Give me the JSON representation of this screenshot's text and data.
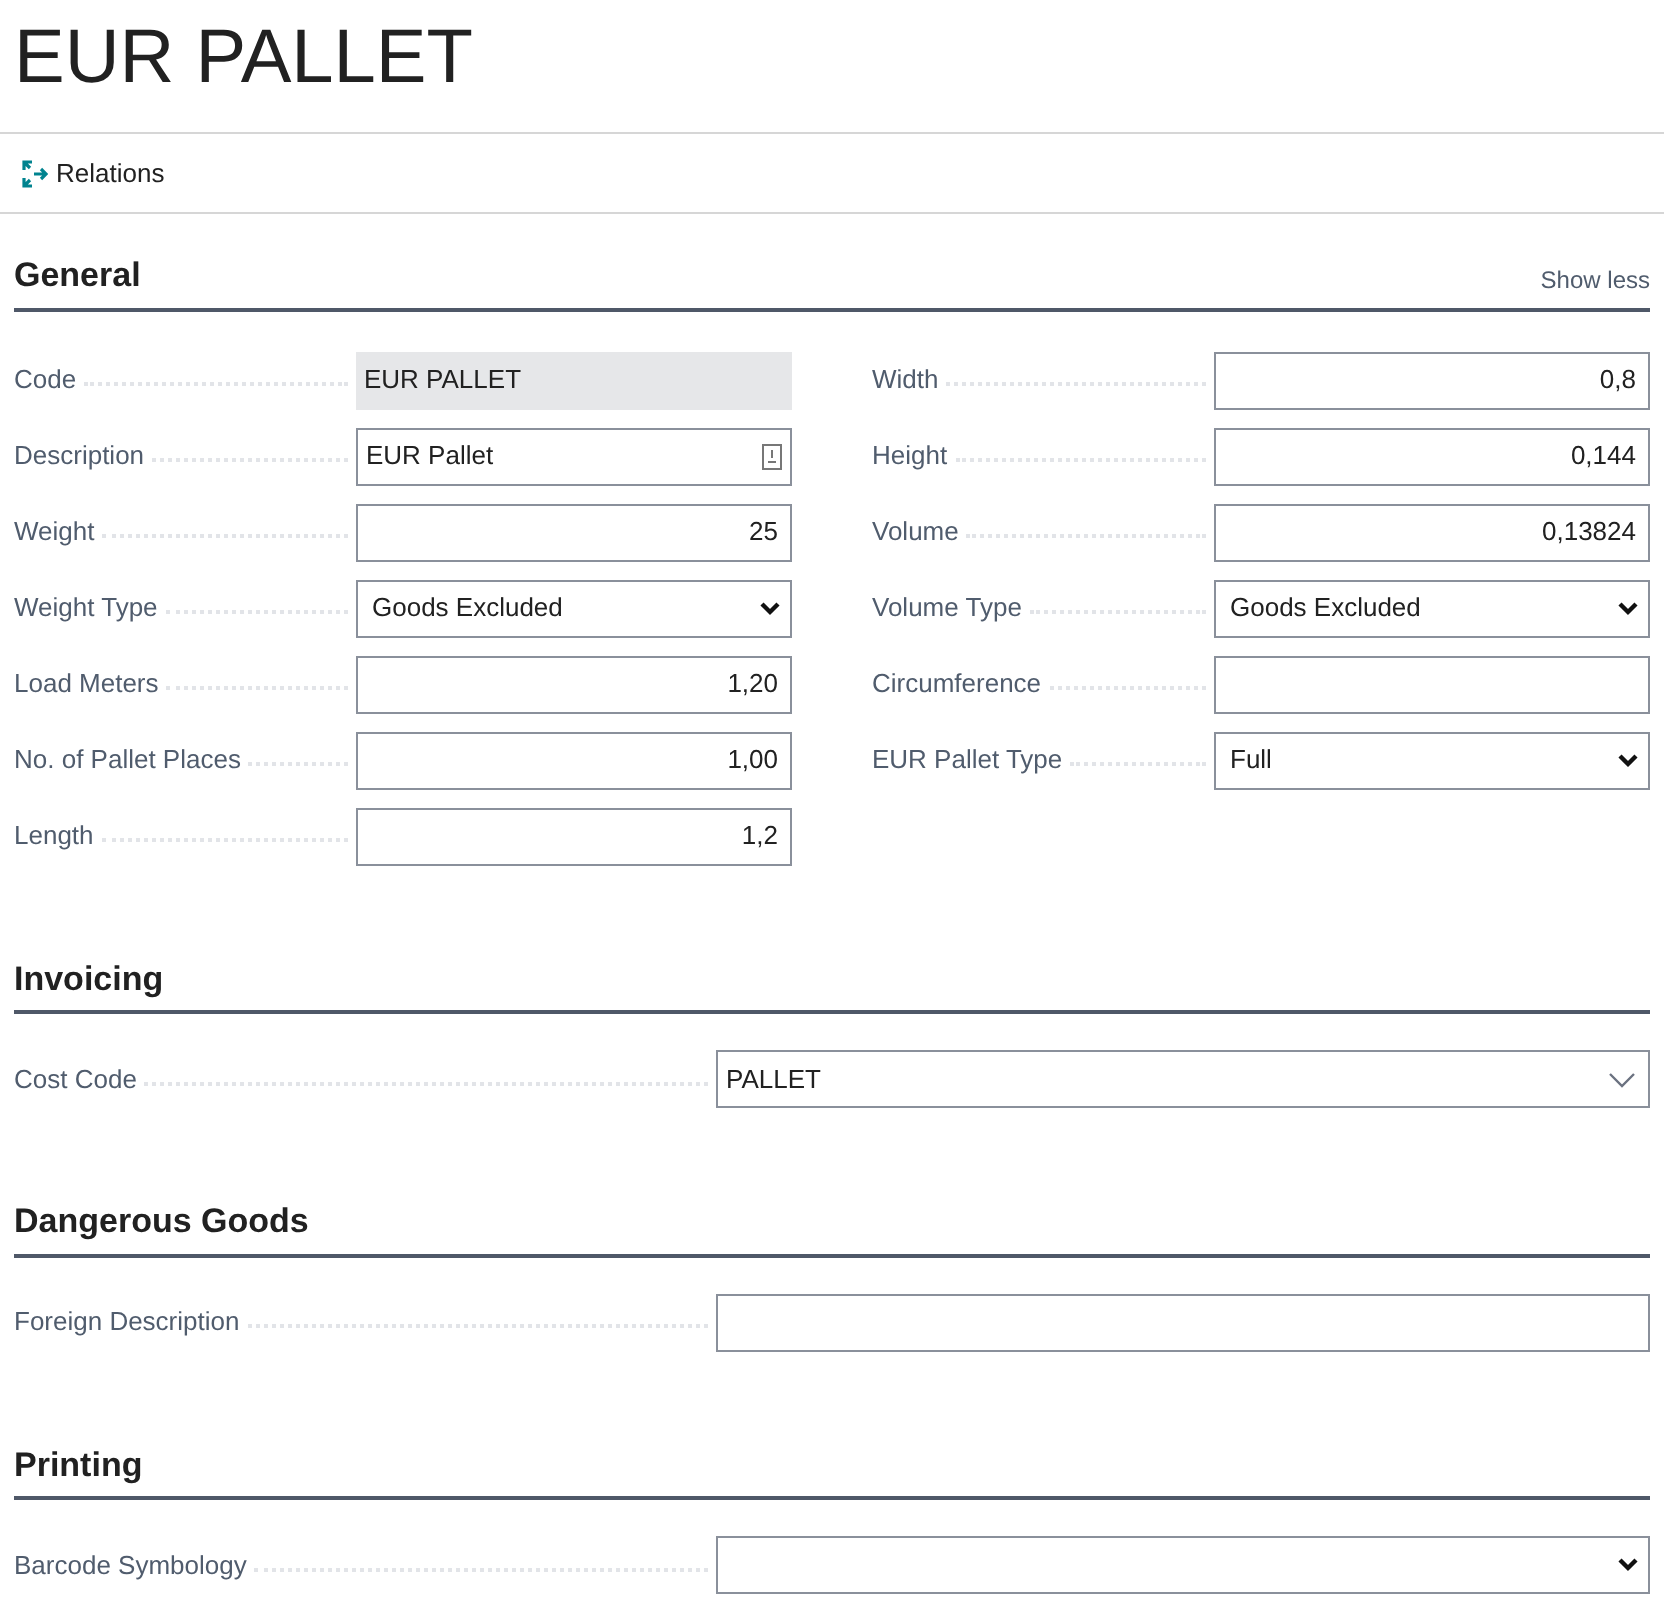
{
  "title": "EUR PALLET",
  "actions": [
    {
      "label": "Relations"
    }
  ],
  "sections": [
    {
      "title": "General",
      "action": "Show less",
      "columns": [
        [
          {
            "label": "Code",
            "kind": "readonly",
            "value": "EUR PALLET"
          },
          {
            "label": "Description",
            "kind": "assist",
            "value": "EUR Pallet"
          },
          {
            "label": "Weight",
            "kind": "number",
            "value": "25"
          },
          {
            "label": "Weight Type",
            "kind": "select",
            "value": "Goods Excluded"
          },
          {
            "label": "Load Meters",
            "kind": "number",
            "value": "1,20"
          },
          {
            "label": "No. of Pallet Places",
            "kind": "number",
            "value": "1,00"
          },
          {
            "label": "Length",
            "kind": "number",
            "value": "1,2"
          }
        ],
        [
          {
            "label": "Width",
            "kind": "number",
            "value": "0,8"
          },
          {
            "label": "Height",
            "kind": "number",
            "value": "0,144"
          },
          {
            "label": "Volume",
            "kind": "number",
            "value": "0,13824"
          },
          {
            "label": "Volume Type",
            "kind": "select",
            "value": "Goods Excluded"
          },
          {
            "label": "Circumference",
            "kind": "number"
          },
          {
            "label": "EUR Pallet Type",
            "kind": "select",
            "value": "Full"
          }
        ]
      ]
    },
    {
      "title": "Invoicing",
      "columns": [
        [
          {
            "label": "Cost Code",
            "kind": "lookup",
            "value": "PALLET"
          }
        ]
      ]
    },
    {
      "title": "Dangerous Goods",
      "columns": [
        [
          {
            "label": "Foreign Description",
            "kind": "text"
          }
        ]
      ]
    },
    {
      "title": "Printing",
      "columns": [
        [
          {
            "label": "Barcode Symbology",
            "kind": "select"
          }
        ]
      ]
    }
  ]
}
